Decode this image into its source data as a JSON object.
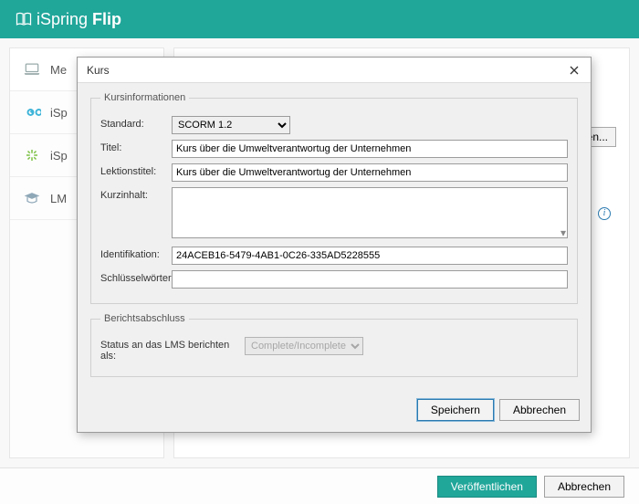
{
  "titlebar": {
    "brand_light": "iSpring ",
    "brand_bold": "Flip"
  },
  "sidebar": {
    "items": [
      {
        "label": "Me"
      },
      {
        "label": "iSp"
      },
      {
        "label": "iSp"
      },
      {
        "label": "LM"
      }
    ]
  },
  "content": {
    "browse_btn": "suchen..."
  },
  "modal": {
    "title": "Kurs",
    "fs1": {
      "legend": "Kursinformationen",
      "standard_label": "Standard:",
      "standard_value": "SCORM 1.2",
      "titel_label": "Titel:",
      "titel_value": "Kurs über die Umweltverantwortug der Unternehmen",
      "lektion_label": "Lektionstitel:",
      "lektion_value": "Kurs über die Umweltverantwortug der Unternehmen",
      "kurz_label": "Kurzinhalt:",
      "kurz_value": "",
      "id_label": "Identifikation:",
      "id_value": "24ACEB16-5479-4AB1-0C26-335AD5228555",
      "keys_label": "Schlüsselwörter:",
      "keys_value": ""
    },
    "fs2": {
      "legend": "Berichtsabschluss",
      "status_label": "Status an das LMS berichten als:",
      "status_value": "Complete/Incomplete"
    },
    "save": "Speichern",
    "cancel": "Abbrechen"
  },
  "footer": {
    "publish": "Veröffentlichen",
    "cancel": "Abbrechen"
  }
}
